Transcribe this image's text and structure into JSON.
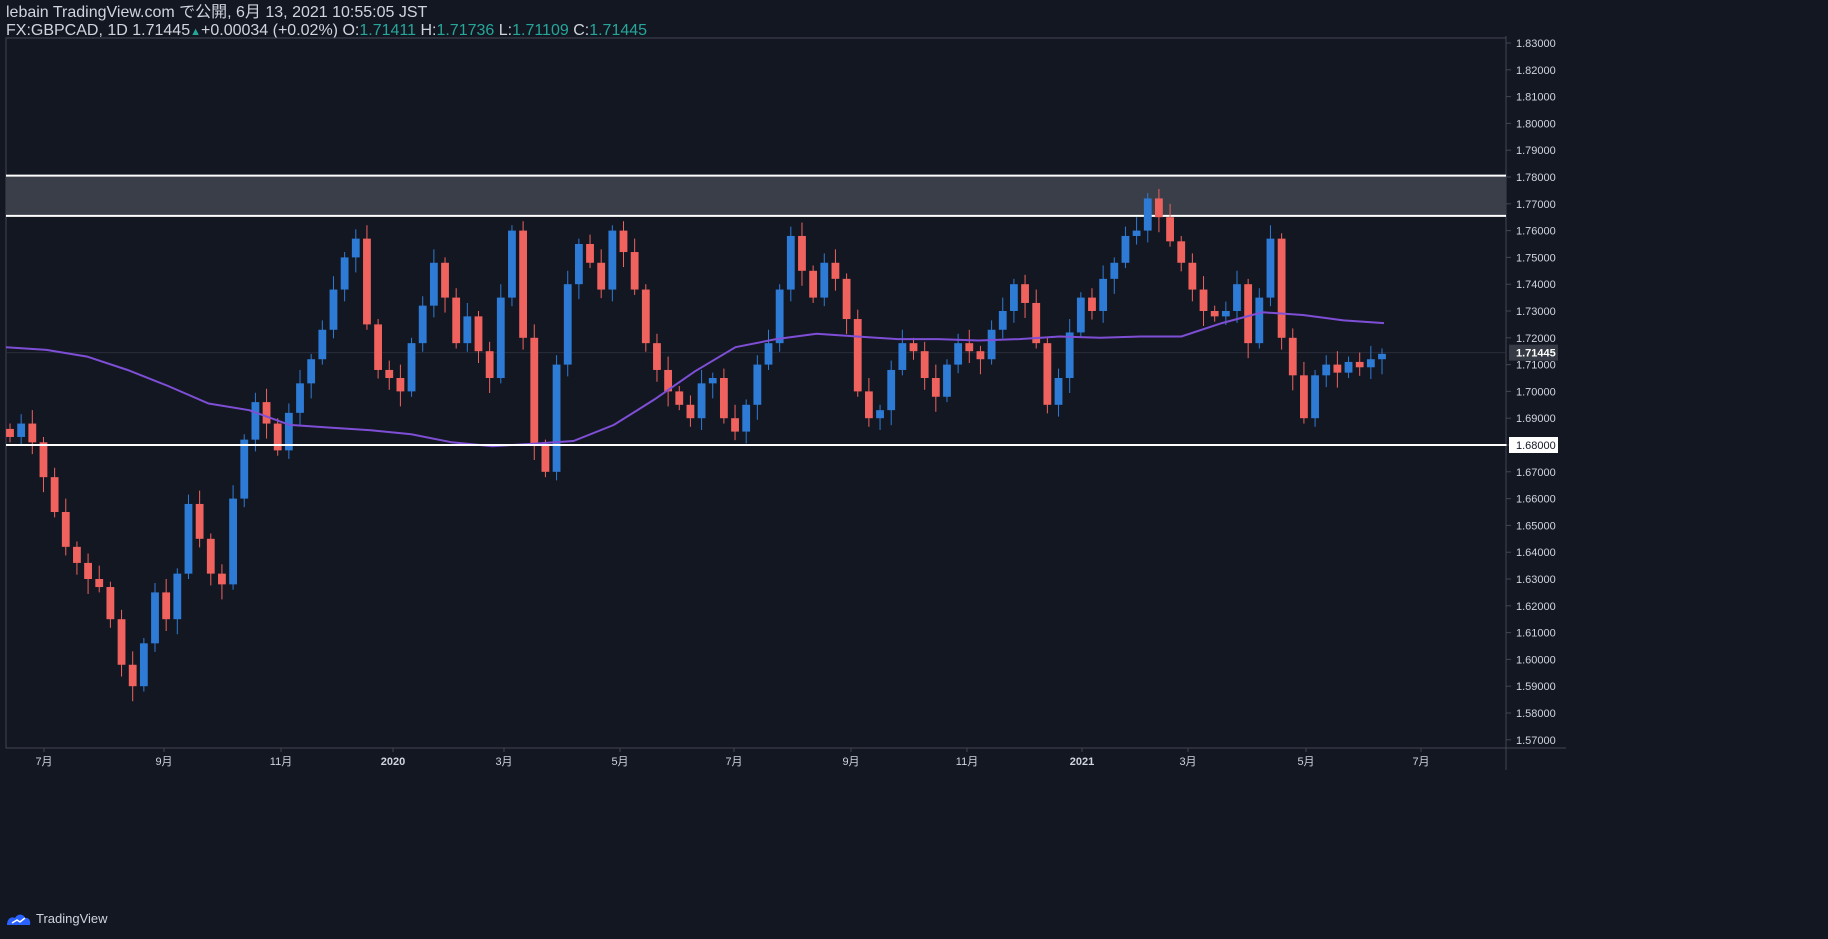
{
  "header": {
    "published_line": "lebain TradingView.com で公開, 6月 13, 2021 10:55:05 JST",
    "symbol": "FX:GBPCAD, 1D",
    "last": "1.71445",
    "change": "+0.00034 (+0.02%)",
    "o_label": "O:",
    "o_value": "1.71411",
    "h_label": "H:",
    "h_value": "1.71736",
    "l_label": "L:",
    "l_value": "1.71109",
    "c_label": "C:",
    "c_value": "1.71445"
  },
  "footer": {
    "brand": "TradingView"
  },
  "colors": {
    "background": "#131722",
    "up": "#2e7bd6",
    "down": "#f0625e",
    "ma": "#7e4fd6",
    "zone_fill": "#3a3e48",
    "level_line": "#ffffff",
    "grid_text": "#d1d4dc",
    "price_label_bg": "#363a45"
  },
  "chart_data": {
    "type": "candlestick",
    "symbol": "FX:GBPCAD",
    "timeframe": "1D",
    "ylim": [
      1.565,
      1.833
    ],
    "y_ticks": [
      "1.83000",
      "1.82000",
      "1.81000",
      "1.80000",
      "1.79000",
      "1.78000",
      "1.77000",
      "1.76000",
      "1.75000",
      "1.74000",
      "1.73000",
      "1.72000",
      "1.71000",
      "1.70000",
      "1.69000",
      "1.68000",
      "1.67000",
      "1.66000",
      "1.65000",
      "1.64000",
      "1.63000",
      "1.62000",
      "1.61000",
      "1.60000",
      "1.59000",
      "1.58000",
      "1.57000"
    ],
    "x_ticks": [
      "7月",
      "9月",
      "11月",
      "2020",
      "3月",
      "5月",
      "7月",
      "9月",
      "11月",
      "2021",
      "3月",
      "5月",
      "7月"
    ],
    "price_label": "1.71445",
    "level_label": "1.68000",
    "resistance_zone": [
      1.7655,
      1.7805
    ],
    "support_level": 1.68,
    "ma_series": [
      1.7165,
      1.7155,
      1.713,
      1.708,
      1.702,
      1.6955,
      1.693,
      1.6875,
      1.6865,
      1.6855,
      1.684,
      1.681,
      1.6795,
      1.6805,
      1.6815,
      1.6875,
      1.697,
      1.7075,
      1.7165,
      1.7195,
      1.7215,
      1.7205,
      1.7195,
      1.7195,
      1.719,
      1.7195,
      1.7205,
      1.72,
      1.7205,
      1.7205,
      1.7255,
      1.7295,
      1.7285,
      1.7265,
      1.7255
    ],
    "candles_close": [
      1.683,
      1.688,
      1.681,
      1.668,
      1.655,
      1.642,
      1.636,
      1.63,
      1.627,
      1.615,
      1.598,
      1.59,
      1.606,
      1.625,
      1.615,
      1.632,
      1.658,
      1.645,
      1.632,
      1.628,
      1.66,
      1.682,
      1.696,
      1.688,
      1.678,
      1.692,
      1.703,
      1.712,
      1.723,
      1.738,
      1.75,
      1.757,
      1.725,
      1.708,
      1.705,
      1.7,
      1.718,
      1.732,
      1.748,
      1.735,
      1.718,
      1.728,
      1.715,
      1.705,
      1.735,
      1.76,
      1.72,
      1.68,
      1.67,
      1.71,
      1.74,
      1.755,
      1.748,
      1.738,
      1.76,
      1.752,
      1.738,
      1.718,
      1.708,
      1.7,
      1.695,
      1.69,
      1.703,
      1.705,
      1.69,
      1.685,
      1.695,
      1.71,
      1.718,
      1.738,
      1.758,
      1.745,
      1.735,
      1.748,
      1.742,
      1.727,
      1.7,
      1.69,
      1.693,
      1.708,
      1.718,
      1.715,
      1.705,
      1.698,
      1.71,
      1.718,
      1.715,
      1.712,
      1.723,
      1.73,
      1.74,
      1.733,
      1.718,
      1.695,
      1.705,
      1.722,
      1.735,
      1.73,
      1.742,
      1.748,
      1.758,
      1.76,
      1.772,
      1.765,
      1.756,
      1.748,
      1.738,
      1.73,
      1.728,
      1.73,
      1.74,
      1.718,
      1.735,
      1.757,
      1.72,
      1.706,
      1.69,
      1.706,
      1.71,
      1.707,
      1.711,
      1.709,
      1.712,
      1.714
    ]
  }
}
